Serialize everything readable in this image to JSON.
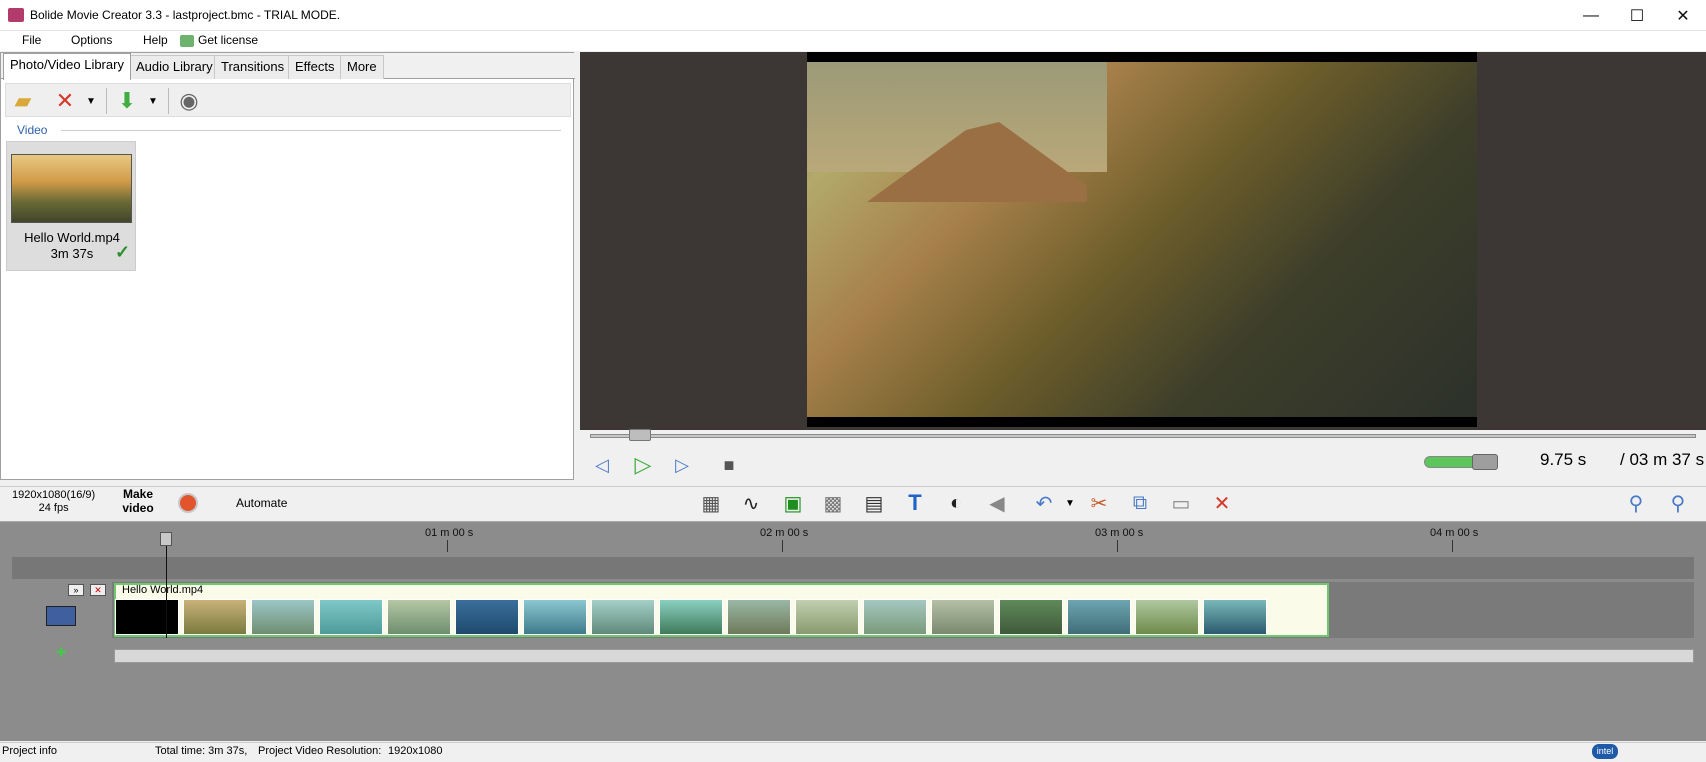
{
  "window": {
    "title": "Bolide Movie Creator 3.3 - lastproject.bmc  - TRIAL MODE.",
    "minimize": "—",
    "maximize": "☐",
    "close": "✕"
  },
  "menu": [
    "File",
    "Options",
    "Help",
    "Get license"
  ],
  "library": {
    "tabs": [
      "Photo/Video Library",
      "Audio Library",
      "Transitions",
      "Effects",
      "More"
    ],
    "active_tab": "Photo/Video Library",
    "section": "Video",
    "item": {
      "name": "Hello World.mp4",
      "duration": "3m 37s"
    }
  },
  "player": {
    "current_time": "9.75 s",
    "total_time": "/ 03 m 37 s",
    "seek_fraction": 0.045,
    "volume_fraction": 0.85
  },
  "bottom": {
    "resolution": "1920x1080(16/9)",
    "fps": "24 fps",
    "make_video": "Make video",
    "automate": "Automate"
  },
  "timeline": {
    "ticks": [
      "01 m 00 s",
      "02 m 00 s",
      "03 m 00 s",
      "04 m 00 s"
    ],
    "clip_name": "Hello World.mp4"
  },
  "status": {
    "project_info": "Project info",
    "total_time": "Total time: 3m 37s,",
    "resolution_label": "Project Video Resolution:",
    "resolution_value": "1920x1080",
    "brand": "intel"
  },
  "icons": {
    "app": "film-icon",
    "open": "folder-open-icon",
    "delete": "delete-icon",
    "import": "down-arrow-icon",
    "webcam": "webcam-icon",
    "prev": "prev-frame-icon",
    "play": "play-icon",
    "next": "next-frame-icon",
    "stop": "stop-icon"
  }
}
